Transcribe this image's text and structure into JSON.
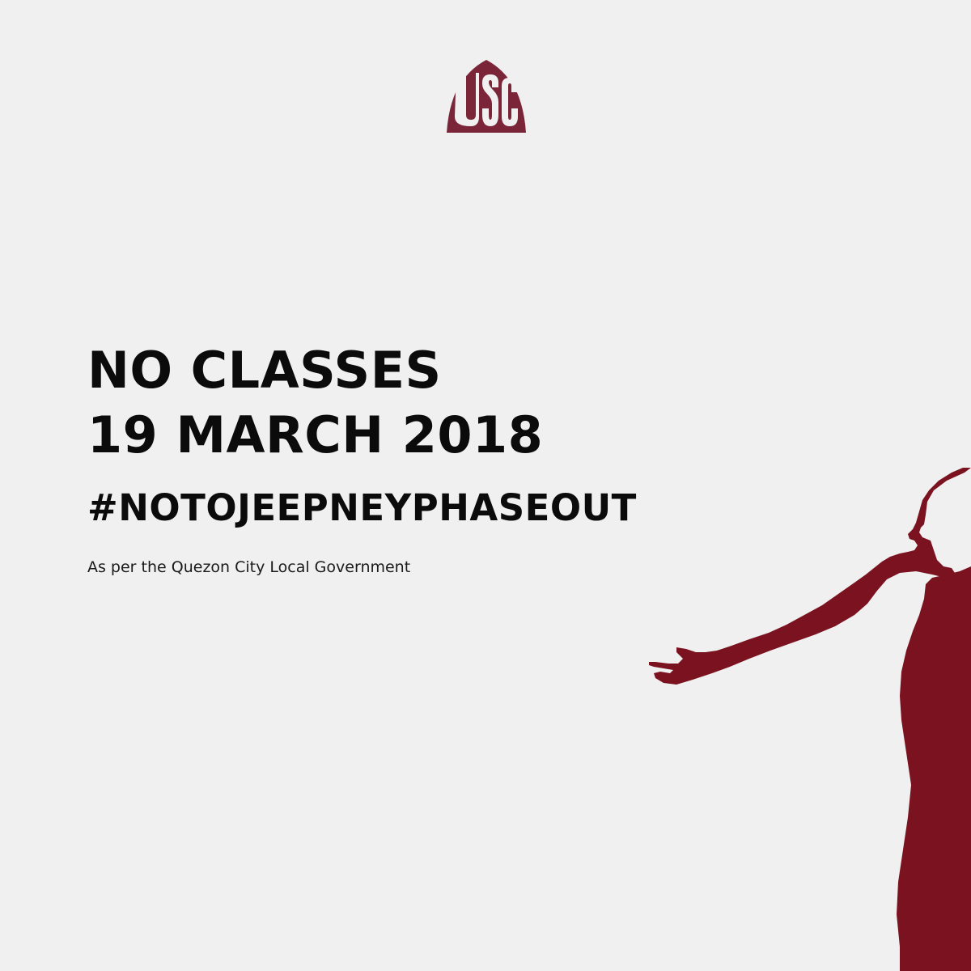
{
  "logo": {
    "text": "USC",
    "color": "#7a2638"
  },
  "announcement": {
    "line1": "NO CLASSES",
    "line2": "19 MARCH 2018",
    "hashtag": "#NOTOJEEPNEYPHASEOUT",
    "note": "As per the Quezon City Local Government"
  },
  "colors": {
    "background": "#f1f0f0",
    "text": "#0b0b0b",
    "silhouette": "#7a1220"
  },
  "graphics": {
    "silhouette_icon": "person-outstretched-arm-silhouette"
  }
}
